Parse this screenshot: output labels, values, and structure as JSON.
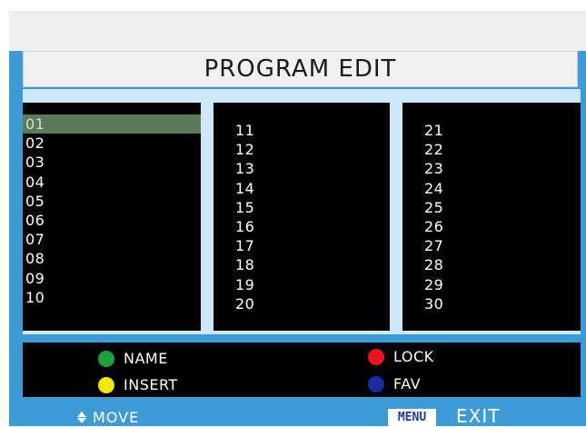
{
  "title": "PROGRAM EDIT",
  "columns": [
    [
      "01",
      "02",
      "03",
      "04",
      "05",
      "06",
      "07",
      "08",
      "09",
      "10"
    ],
    [
      "11",
      "12",
      "13",
      "14",
      "15",
      "16",
      "17",
      "18",
      "19",
      "20"
    ],
    [
      "21",
      "22",
      "23",
      "24",
      "25",
      "26",
      "27",
      "28",
      "29",
      "30"
    ]
  ],
  "selected": "01",
  "legend": {
    "name": {
      "label": "NAME",
      "color": "#1aa33c",
      "icon": "green-dot-icon"
    },
    "lock": {
      "label": "LOCK",
      "color": "#e8141e",
      "icon": "red-dot-icon"
    },
    "insert": {
      "label": "INSERT",
      "color": "#f3e600",
      "icon": "yellow-dot-icon"
    },
    "fav": {
      "label": "FAV",
      "color": "#1a2aa0",
      "icon": "blue-dot-icon"
    }
  },
  "footer": {
    "move_label": "MOVE",
    "menu_label": "MENU",
    "exit_label": "EXIT"
  },
  "colors": {
    "panel": "#3d9bd6",
    "list_bg": "#000000",
    "highlight": "#5a7a5a"
  }
}
